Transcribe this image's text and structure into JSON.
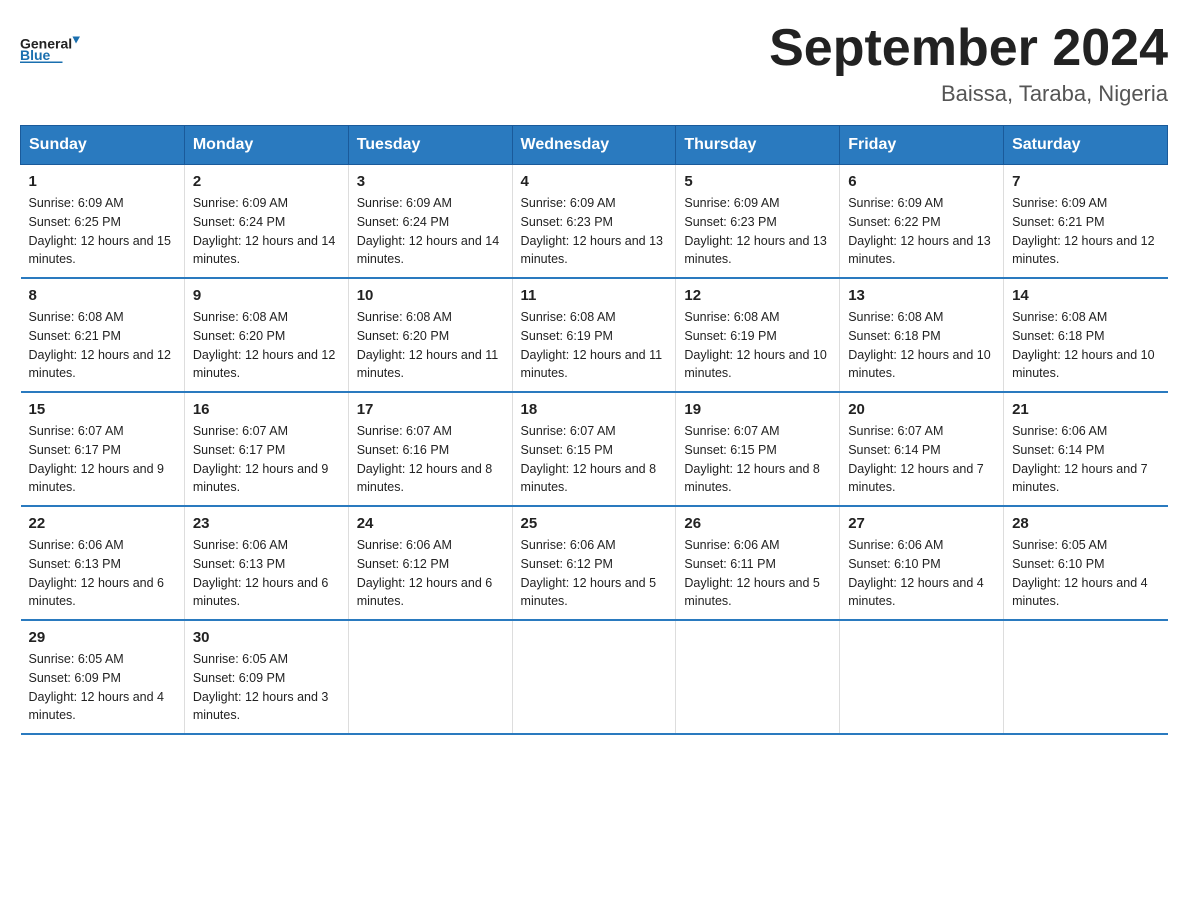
{
  "header": {
    "logo_general": "General",
    "logo_blue": "Blue",
    "title": "September 2024",
    "subtitle": "Baissa, Taraba, Nigeria"
  },
  "days_of_week": [
    "Sunday",
    "Monday",
    "Tuesday",
    "Wednesday",
    "Thursday",
    "Friday",
    "Saturday"
  ],
  "weeks": [
    [
      {
        "day": "1",
        "sunrise": "6:09 AM",
        "sunset": "6:25 PM",
        "daylight": "12 hours and 15 minutes."
      },
      {
        "day": "2",
        "sunrise": "6:09 AM",
        "sunset": "6:24 PM",
        "daylight": "12 hours and 14 minutes."
      },
      {
        "day": "3",
        "sunrise": "6:09 AM",
        "sunset": "6:24 PM",
        "daylight": "12 hours and 14 minutes."
      },
      {
        "day": "4",
        "sunrise": "6:09 AM",
        "sunset": "6:23 PM",
        "daylight": "12 hours and 13 minutes."
      },
      {
        "day": "5",
        "sunrise": "6:09 AM",
        "sunset": "6:23 PM",
        "daylight": "12 hours and 13 minutes."
      },
      {
        "day": "6",
        "sunrise": "6:09 AM",
        "sunset": "6:22 PM",
        "daylight": "12 hours and 13 minutes."
      },
      {
        "day": "7",
        "sunrise": "6:09 AM",
        "sunset": "6:21 PM",
        "daylight": "12 hours and 12 minutes."
      }
    ],
    [
      {
        "day": "8",
        "sunrise": "6:08 AM",
        "sunset": "6:21 PM",
        "daylight": "12 hours and 12 minutes."
      },
      {
        "day": "9",
        "sunrise": "6:08 AM",
        "sunset": "6:20 PM",
        "daylight": "12 hours and 12 minutes."
      },
      {
        "day": "10",
        "sunrise": "6:08 AM",
        "sunset": "6:20 PM",
        "daylight": "12 hours and 11 minutes."
      },
      {
        "day": "11",
        "sunrise": "6:08 AM",
        "sunset": "6:19 PM",
        "daylight": "12 hours and 11 minutes."
      },
      {
        "day": "12",
        "sunrise": "6:08 AM",
        "sunset": "6:19 PM",
        "daylight": "12 hours and 10 minutes."
      },
      {
        "day": "13",
        "sunrise": "6:08 AM",
        "sunset": "6:18 PM",
        "daylight": "12 hours and 10 minutes."
      },
      {
        "day": "14",
        "sunrise": "6:08 AM",
        "sunset": "6:18 PM",
        "daylight": "12 hours and 10 minutes."
      }
    ],
    [
      {
        "day": "15",
        "sunrise": "6:07 AM",
        "sunset": "6:17 PM",
        "daylight": "12 hours and 9 minutes."
      },
      {
        "day": "16",
        "sunrise": "6:07 AM",
        "sunset": "6:17 PM",
        "daylight": "12 hours and 9 minutes."
      },
      {
        "day": "17",
        "sunrise": "6:07 AM",
        "sunset": "6:16 PM",
        "daylight": "12 hours and 8 minutes."
      },
      {
        "day": "18",
        "sunrise": "6:07 AM",
        "sunset": "6:15 PM",
        "daylight": "12 hours and 8 minutes."
      },
      {
        "day": "19",
        "sunrise": "6:07 AM",
        "sunset": "6:15 PM",
        "daylight": "12 hours and 8 minutes."
      },
      {
        "day": "20",
        "sunrise": "6:07 AM",
        "sunset": "6:14 PM",
        "daylight": "12 hours and 7 minutes."
      },
      {
        "day": "21",
        "sunrise": "6:06 AM",
        "sunset": "6:14 PM",
        "daylight": "12 hours and 7 minutes."
      }
    ],
    [
      {
        "day": "22",
        "sunrise": "6:06 AM",
        "sunset": "6:13 PM",
        "daylight": "12 hours and 6 minutes."
      },
      {
        "day": "23",
        "sunrise": "6:06 AM",
        "sunset": "6:13 PM",
        "daylight": "12 hours and 6 minutes."
      },
      {
        "day": "24",
        "sunrise": "6:06 AM",
        "sunset": "6:12 PM",
        "daylight": "12 hours and 6 minutes."
      },
      {
        "day": "25",
        "sunrise": "6:06 AM",
        "sunset": "6:12 PM",
        "daylight": "12 hours and 5 minutes."
      },
      {
        "day": "26",
        "sunrise": "6:06 AM",
        "sunset": "6:11 PM",
        "daylight": "12 hours and 5 minutes."
      },
      {
        "day": "27",
        "sunrise": "6:06 AM",
        "sunset": "6:10 PM",
        "daylight": "12 hours and 4 minutes."
      },
      {
        "day": "28",
        "sunrise": "6:05 AM",
        "sunset": "6:10 PM",
        "daylight": "12 hours and 4 minutes."
      }
    ],
    [
      {
        "day": "29",
        "sunrise": "6:05 AM",
        "sunset": "6:09 PM",
        "daylight": "12 hours and 4 minutes."
      },
      {
        "day": "30",
        "sunrise": "6:05 AM",
        "sunset": "6:09 PM",
        "daylight": "12 hours and 3 minutes."
      },
      null,
      null,
      null,
      null,
      null
    ]
  ],
  "labels": {
    "sunrise": "Sunrise:",
    "sunset": "Sunset:",
    "daylight": "Daylight:"
  }
}
